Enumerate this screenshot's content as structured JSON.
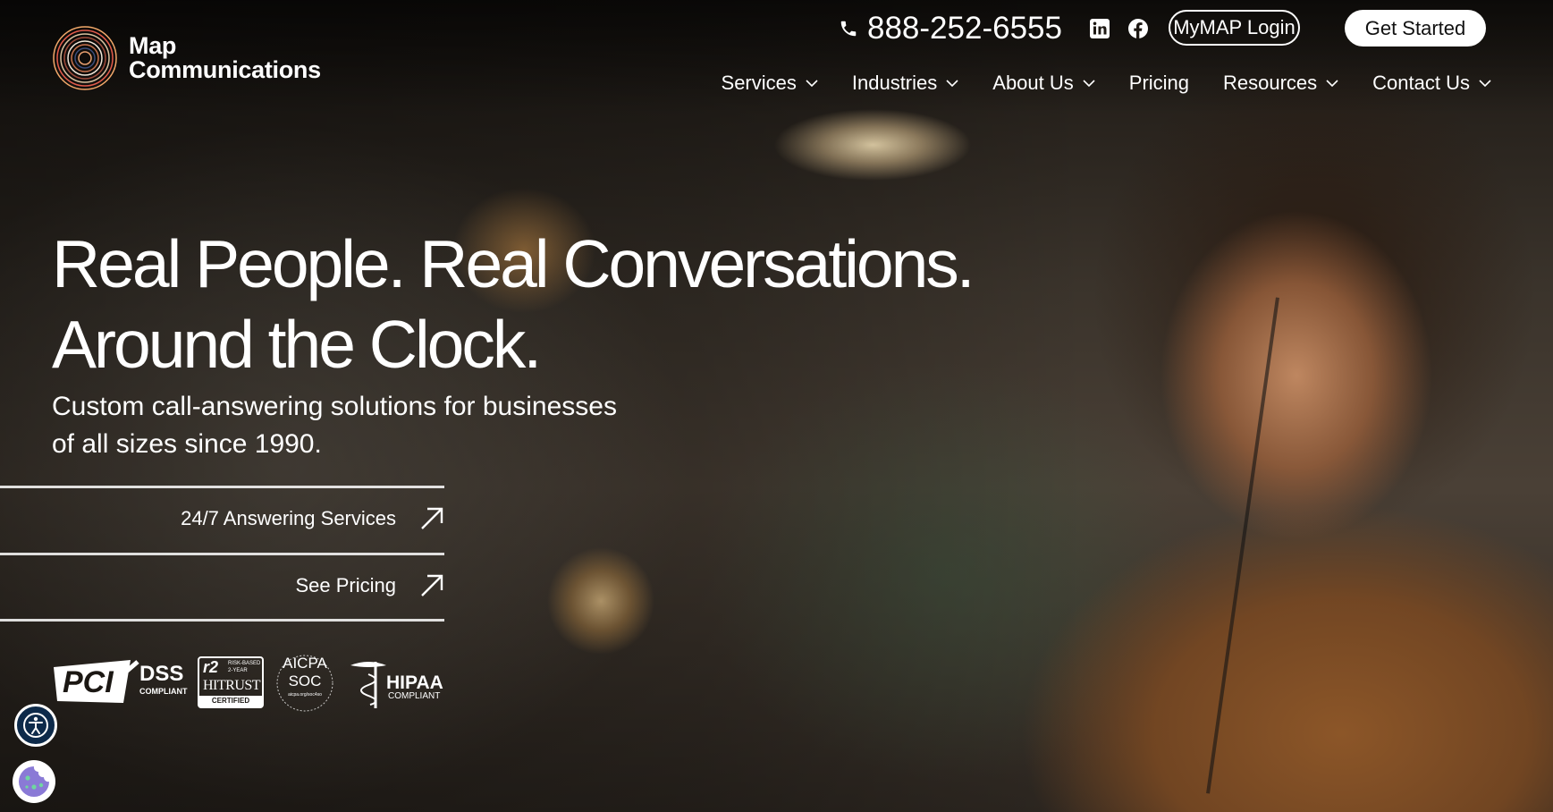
{
  "brand": {
    "name_line1": "Map",
    "name_line2": "Communications",
    "logo_icon": "concentric-rings-logo"
  },
  "header": {
    "phone": "888-252-6555",
    "phone_icon": "phone-icon",
    "social": [
      {
        "name": "linkedin",
        "icon": "linkedin-icon"
      },
      {
        "name": "facebook",
        "icon": "facebook-icon"
      }
    ],
    "login_label": "MyMAP Login",
    "get_started_label": "Get Started"
  },
  "nav": {
    "items": [
      {
        "label": "Services",
        "has_dropdown": true
      },
      {
        "label": "Industries",
        "has_dropdown": true
      },
      {
        "label": "About Us",
        "has_dropdown": true
      },
      {
        "label": "Pricing",
        "has_dropdown": false
      },
      {
        "label": "Resources",
        "has_dropdown": true
      },
      {
        "label": "Contact Us",
        "has_dropdown": true
      }
    ]
  },
  "hero": {
    "headline_line1": "Real People. Real Conversations.",
    "headline_line2": "Around the Clock.",
    "subheading_line1": "Custom call-answering solutions for businesses",
    "subheading_line2": "of all sizes since 1990.",
    "cta": [
      {
        "label": "24/7 Answering Services",
        "icon": "arrow-up-right-icon"
      },
      {
        "label": "See Pricing",
        "icon": "arrow-up-right-icon"
      }
    ]
  },
  "badges": {
    "pci": {
      "main": "PCI",
      "dss": "DSS",
      "compliant": "COMPLIANT"
    },
    "hitrust": {
      "r2": "r2",
      "risk": "RISK-BASED",
      "year": "2-YEAR",
      "name": "HITRUST",
      "certified": "CERTIFIED"
    },
    "aicpa": {
      "line1": "AICPA",
      "line2": "SOC",
      "line3": "aicpa.org/soc4so"
    },
    "hipaa": {
      "name": "HIPAA",
      "compliant": "COMPLIANT"
    }
  },
  "floating": {
    "accessibility_icon": "accessibility-icon",
    "cookie_icon": "cookie-icon"
  },
  "colors": {
    "text": "#ffffff",
    "button_solid_bg": "#ffffff",
    "button_solid_text": "#111111",
    "accessibility_bg": "#0d2a4a"
  }
}
